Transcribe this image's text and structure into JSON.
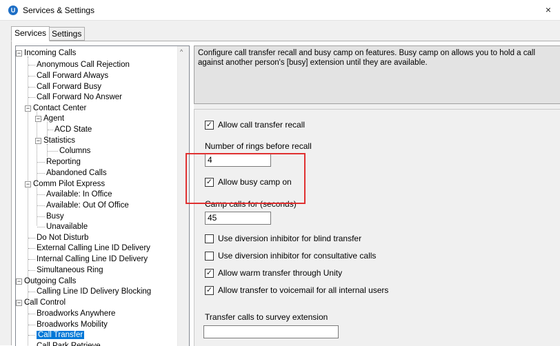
{
  "window": {
    "title": "Services & Settings",
    "close_glyph": "×",
    "app_icon_glyph": "U",
    "app_icon_color": "#1e6fc6"
  },
  "tabs": [
    {
      "label": "Services",
      "active": true
    },
    {
      "label": "Settings",
      "active": false
    }
  ],
  "tree": {
    "items": [
      {
        "label": "Incoming Calls",
        "expander": "−"
      },
      {
        "label": "Anonymous Call Rejection"
      },
      {
        "label": "Call Forward Always"
      },
      {
        "label": "Call Forward Busy"
      },
      {
        "label": "Call Forward No Answer"
      },
      {
        "label": "Contact Center",
        "expander": "−"
      },
      {
        "label": "Agent",
        "expander": "−"
      },
      {
        "label": "ACD State"
      },
      {
        "label": "Statistics",
        "expander": "−"
      },
      {
        "label": "Columns"
      },
      {
        "label": "Reporting"
      },
      {
        "label": "Abandoned Calls"
      },
      {
        "label": "Comm Pilot Express",
        "expander": "−"
      },
      {
        "label": "Available: In Office"
      },
      {
        "label": "Available: Out Of Office"
      },
      {
        "label": "Busy"
      },
      {
        "label": "Unavailable"
      },
      {
        "label": "Do Not Disturb"
      },
      {
        "label": "External Calling Line ID Delivery"
      },
      {
        "label": "Internal Calling Line ID Delivery"
      },
      {
        "label": "Simultaneous Ring"
      },
      {
        "label": "Outgoing Calls",
        "expander": "−"
      },
      {
        "label": "Calling Line ID Delivery Blocking"
      },
      {
        "label": "Call Control",
        "expander": "−"
      },
      {
        "label": "Broadworks Anywhere"
      },
      {
        "label": "Broadworks Mobility"
      },
      {
        "label": "Call Transfer",
        "selected": true
      },
      {
        "label": "Call Park Retrieve"
      }
    ],
    "scroll_up_glyph": "^",
    "selection_color": "#0078d7"
  },
  "description": "Configure call transfer recall and busy camp on features.  Busy camp on allows you to hold a call against another person's [busy] extension until they are available.",
  "settings": {
    "allow_recall": {
      "label": "Allow call transfer recall",
      "checked": true
    },
    "rings_label": "Number of rings before recall",
    "rings_value": "4",
    "allow_busy_camp": {
      "label": "Allow busy camp on",
      "checked": true
    },
    "camp_label": "Camp calls for (seconds)",
    "camp_value": "45",
    "diversion_blind": {
      "label": "Use diversion inhibitor for blind transfer",
      "checked": false
    },
    "diversion_consult": {
      "label": "Use diversion inhibitor for consultative calls",
      "checked": false
    },
    "warm_transfer": {
      "label": "Allow warm transfer through Unity",
      "checked": true
    },
    "voicemail_transfer": {
      "label": "Allow transfer to voicemail for all internal users",
      "checked": true
    },
    "survey_label": "Transfer calls to survey extension",
    "survey_value": ""
  },
  "check_glyph": "✓",
  "highlight_color": "#e03030"
}
